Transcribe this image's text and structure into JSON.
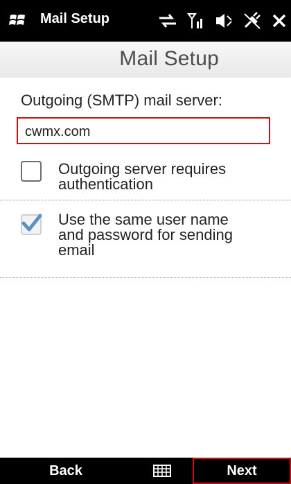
{
  "titlebar": {
    "title": "Mail Setup",
    "icons": [
      "windows-logo",
      "sync-icon",
      "signal-icon",
      "volume-icon",
      "power-plug-icon",
      "close-icon"
    ],
    "background": "#000000"
  },
  "header": {
    "title": "Mail Setup"
  },
  "form": {
    "smtp_label": "Outgoing (SMTP) mail server:",
    "smtp_value": "cwmx.com",
    "options": [
      {
        "label_line1": "Outgoing server requires",
        "label_line2": "authentication",
        "checked": false,
        "enabled": true
      },
      {
        "label_line1": "Use the same user name",
        "label_line2": "and password for sending",
        "label_line3": "email",
        "checked": true,
        "enabled": false
      }
    ]
  },
  "softkeys": {
    "left": "Back",
    "right": "Next",
    "middle_icon": "keyboard-icon"
  },
  "colors": {
    "accent_red": "#d01010",
    "check_blue": "#5a8fc9"
  }
}
